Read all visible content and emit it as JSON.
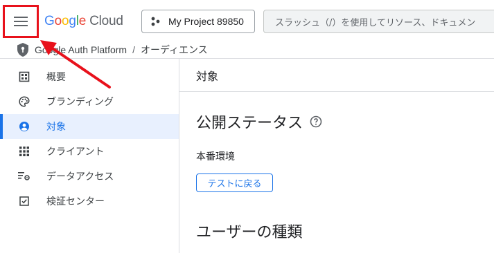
{
  "header": {
    "logo": {
      "letters": [
        "G",
        "o",
        "o",
        "g",
        "l",
        "e"
      ],
      "product": "Cloud"
    },
    "project_label": "My Project 89850",
    "search_placeholder": "スラッシュ（/）を使用してリソース、ドキュメン"
  },
  "breadcrumb": {
    "product": "Google Auth Platform",
    "separator": "/",
    "page": "オーディエンス"
  },
  "sidebar": {
    "items": [
      {
        "label": "概要",
        "icon": "dashboard-icon",
        "active": false
      },
      {
        "label": "ブランディング",
        "icon": "palette-icon",
        "active": false
      },
      {
        "label": "対象",
        "icon": "account-circle-icon",
        "active": true
      },
      {
        "label": "クライアント",
        "icon": "apps-grid-icon",
        "active": false
      },
      {
        "label": "データアクセス",
        "icon": "data-settings-icon",
        "active": false
      },
      {
        "label": "検証センター",
        "icon": "verified-checkbox-icon",
        "active": false
      }
    ]
  },
  "main": {
    "section_title": "対象",
    "publishing_status_heading": "公開ステータス",
    "environment_label": "本番環境",
    "back_to_testing_label": "テストに戻る",
    "user_type_heading": "ユーザーの種類"
  },
  "colors": {
    "accent": "#1a73e8",
    "active_bg": "#e8f0fe",
    "annotation": "#e8111b"
  }
}
